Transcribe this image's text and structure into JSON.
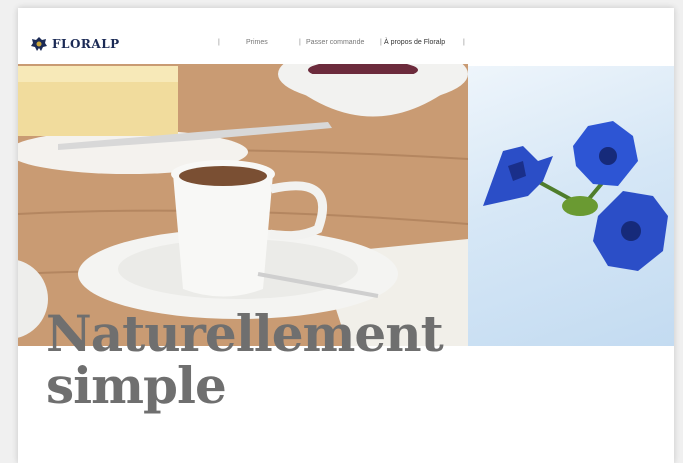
{
  "brand": {
    "name": "FLORALP",
    "color": "#1b2a55"
  },
  "nav": {
    "items": [
      {
        "label": "Primes"
      },
      {
        "label": "Passer commande"
      },
      {
        "label": "À propos de Floralp"
      }
    ],
    "separator": "|"
  },
  "hero": {
    "headline_line1": "Naturellement",
    "headline_line2": "simple"
  },
  "colors": {
    "headline": "#6f6f6f",
    "flower": "#2545c8",
    "background": "#ffffff"
  },
  "icons": {
    "logo": "floralp-edelweiss-logo"
  }
}
